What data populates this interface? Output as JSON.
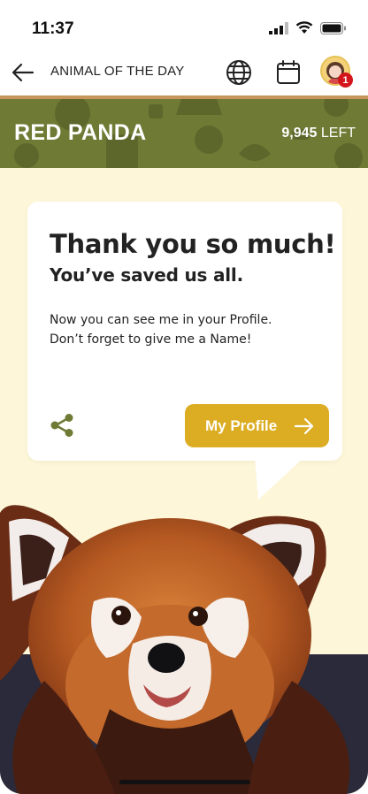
{
  "status_bar": {
    "time": "11:37"
  },
  "app_bar": {
    "title": "ANIMAL OF THE DAY",
    "notification_count": "1"
  },
  "banner": {
    "animal_name": "RED PANDA",
    "count": "9,945",
    "count_suffix": "LEFT",
    "color": "#6f7a35"
  },
  "card": {
    "heading": "Thank you so much!",
    "subheading": "You’ve saved us all.",
    "body_line1": "Now you can see me in your Profile.",
    "body_line2": "Don’t forget to give me a Name!",
    "button_label": "My Profile",
    "button_color": "#dcad22"
  },
  "colors": {
    "background": "#fdf6d8",
    "accent_strip": "#c8955c"
  },
  "icons": [
    "back-arrow-icon",
    "globe-icon",
    "calendar-icon",
    "share-icon",
    "arrow-right-icon"
  ]
}
